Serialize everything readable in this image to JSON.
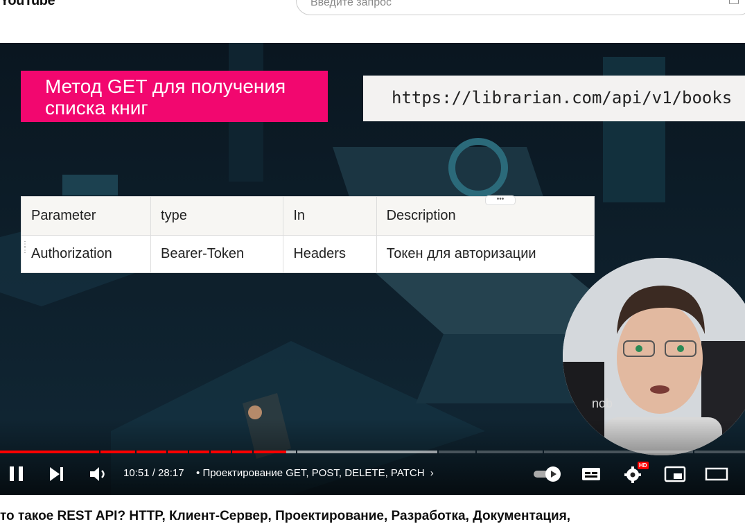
{
  "header": {
    "logo_text": "YouTube",
    "search_placeholder": "Введите запрос"
  },
  "slide": {
    "title_line1": "Метод GET для получения",
    "title_line2": "списка книг",
    "url": "https://librarian.com/api/v1/books",
    "table": {
      "headers": [
        "Parameter",
        "type",
        "In",
        "Description"
      ],
      "rows": [
        [
          "Authorization",
          "Bearer-Token",
          "Headers",
          "Токен для авторизации"
        ]
      ]
    },
    "webcam_brand": "nob"
  },
  "player": {
    "current_time": "10:51",
    "duration": "28:17",
    "time_display": "10:51 / 28:17",
    "chapter_separator": "•",
    "chapter_title": "Проектирование GET, POST, DELETE, PATCH",
    "progress_fraction": 0.384,
    "buffer_fraction": 0.587,
    "hd_badge": "HD",
    "accent_color": "#ff0000"
  },
  "video_title": "то такое REST API? HTTP, Клиент-Сервер, Проектирование, Разработка, Документация,"
}
